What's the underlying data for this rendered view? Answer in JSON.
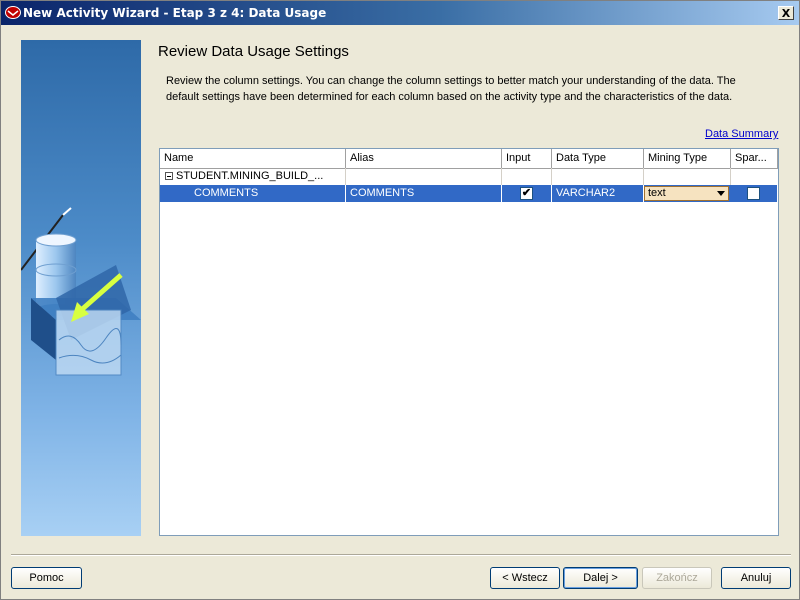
{
  "window": {
    "title": "New Activity Wizard - Etap 3 z 4: Data Usage",
    "close_label": "X"
  },
  "page": {
    "heading": "Review Data Usage Settings",
    "description": "Review the column settings. You can change the column settings to better match your understanding of the data. The default settings have been determined for each column based on the activity type and the characteristics of the data.",
    "summary_link": "Data Summary"
  },
  "table": {
    "columns": [
      "Name",
      "Alias",
      "Input",
      "Data Type",
      "Mining Type",
      "Spar..."
    ],
    "parent_row": {
      "name": "STUDENT.MINING_BUILD_...",
      "expanded": true
    },
    "rows": [
      {
        "name": "COMMENTS",
        "alias": "COMMENTS",
        "input": true,
        "data_type": "VARCHAR2",
        "mining_type": "text",
        "sparse": false,
        "selected": true
      }
    ]
  },
  "buttons": {
    "help": "Pomoc",
    "back": "< Wstecz",
    "next": "Dalej >",
    "finish": "Zakończ",
    "cancel": "Anuluj"
  },
  "colors": {
    "selection": "#3169c6",
    "link": "#0000cc",
    "combo_bg": "#f6e3c0"
  }
}
